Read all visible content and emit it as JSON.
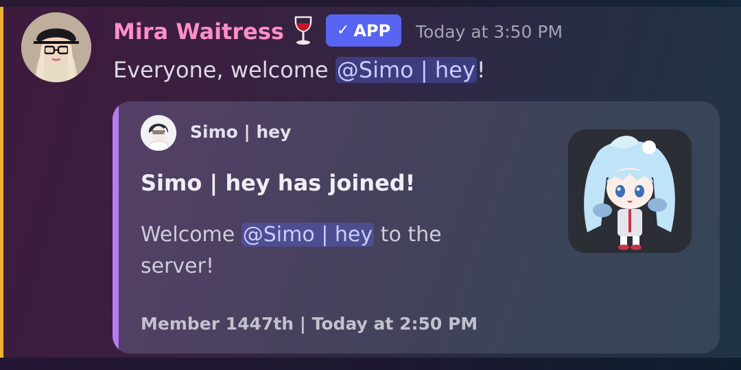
{
  "message": {
    "author": {
      "name": "Mira Waitress",
      "emoji_icon": "wine-glass-icon",
      "badge_label": "APP",
      "badge_color": "#5865f2",
      "name_color": "#ff8ec8"
    },
    "timestamp": "Today at 3:50 PM",
    "text_before": "Everyone, welcome ",
    "mention": "@Simo | hey",
    "text_after": "!"
  },
  "embed": {
    "accent_color": "#b57bf0",
    "author_name": "Simo | hey",
    "title": "Simo | hey has joined!",
    "desc_before": "Welcome ",
    "desc_mention": "@Simo | hey",
    "desc_after": " to the server!",
    "footer": "Member 1447th | Today at 2:50 PM"
  },
  "colors": {
    "highlight_bar": "#f0b232"
  }
}
